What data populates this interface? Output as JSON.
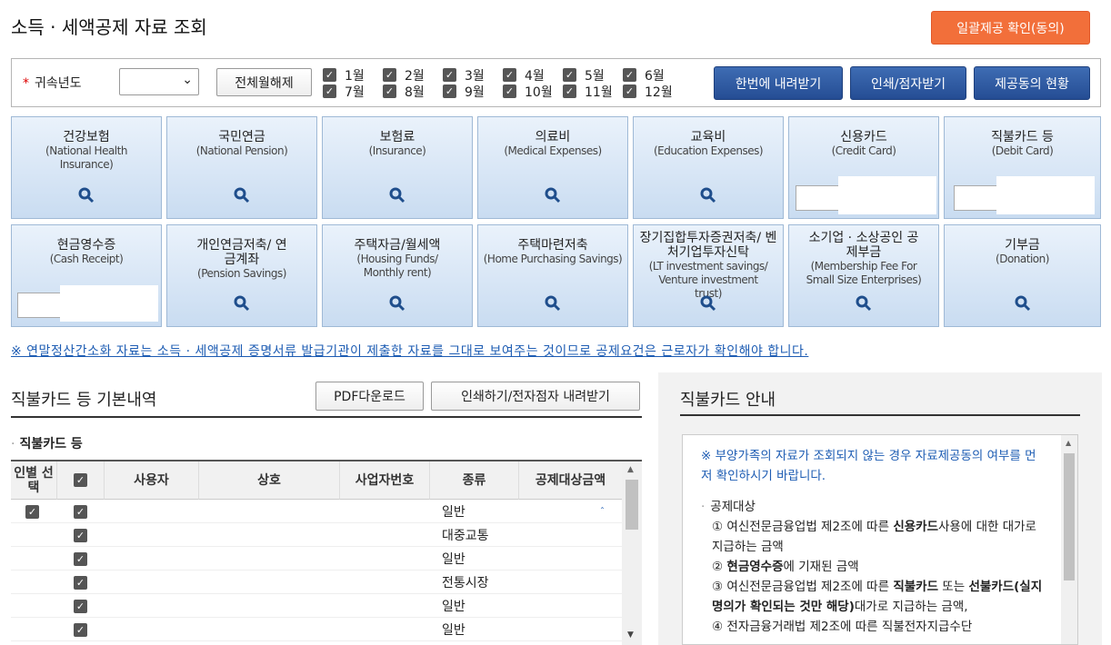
{
  "header": {
    "title": "소득 · 세액공제 자료 조회",
    "consent_button": "일괄제공 확인(동의)"
  },
  "filter": {
    "year_label": "귀속년도",
    "year_value": "",
    "deselect_all": "전체월해제",
    "months": [
      "1월",
      "2월",
      "3월",
      "4월",
      "5월",
      "6월",
      "7월",
      "8월",
      "9월",
      "10월",
      "11월",
      "12월"
    ],
    "download_all": "한번에 내려받기",
    "print_button": "인쇄/점자받기",
    "consent_status": "제공동의 현황"
  },
  "tiles": [
    {
      "ko": "건강보험",
      "en": "(National Health Insurance)"
    },
    {
      "ko": "국민연금",
      "en": "(National Pension)"
    },
    {
      "ko": "보험료",
      "en": "(Insurance)"
    },
    {
      "ko": "의료비",
      "en": "(Medical Expenses)"
    },
    {
      "ko": "교육비",
      "en": "(Education Expenses)"
    },
    {
      "ko": "신용카드",
      "en": "(Credit Card)"
    },
    {
      "ko": "직불카드 등",
      "en": "(Debit Card)"
    },
    {
      "ko": "현금영수증",
      "en": "(Cash Receipt)"
    },
    {
      "ko": "개인연금저축/ 연금계좌",
      "en": "(Pension Savings)"
    },
    {
      "ko": "주택자금/월세액",
      "en": "(Housing Funds/ Monthly rent)"
    },
    {
      "ko": "주택마련저축",
      "en": "(Home Purchasing Savings)"
    },
    {
      "ko": "장기집합투자증권저축/ 벤처기업투자신탁",
      "en": "(LT investment savings/ Venture investment trust)"
    },
    {
      "ko": "소기업 · 소상공인 공제부금",
      "en": "(Membership Fee For Small Size Enterprises)"
    },
    {
      "ko": "기부금",
      "en": "(Donation)"
    }
  ],
  "notice": "※ 연말정산간소화 자료는 소득 · 세액공제 증명서류 발급기관이 제출한 자료를 그대로 보여주는 것이므로 공제요건은 근로자가 확인해야 합니다.",
  "detail": {
    "title": "직불카드 등 기본내역",
    "pdf_button": "PDF다운로드",
    "print_button": "인쇄하기/전자점자 내려받기",
    "section_label": "직불카드 등",
    "columns": [
      "인별 선택",
      "",
      "사용자",
      "상호",
      "사업자번호",
      "종류",
      "공제대상금액"
    ],
    "rows": [
      {
        "type": "일반"
      },
      {
        "type": "대중교통"
      },
      {
        "type": "일반"
      },
      {
        "type": "전통시장"
      },
      {
        "type": "일반"
      },
      {
        "type": "일반"
      }
    ]
  },
  "guide": {
    "title": "직불카드 안내",
    "line1": "※ 부양가족의 자료가 조회되지 않는 경우 자료제공동의 여부를 먼저 확인하시기 바랍니다.",
    "bullet": "공제대상",
    "item1a": "① 여신전문금융업법 제2조에 따른 ",
    "item1b": "신용카드",
    "item1c": "사용에 대한 대가로 지급하는 금액",
    "item2a": "② ",
    "item2b": "현금영수증",
    "item2c": "에 기재된 금액",
    "item3a": "③ 여신전문금융업법 제2조에 따른 ",
    "item3b": "직불카드",
    "item3c": " 또는 ",
    "item3d": "선불카드(실지명의가 확인되는 것만 해당)",
    "item3e": "대가로 지급하는 금액,",
    "item4": "④ 전자금융거래법 제2조에 따른 직불전자지급수단"
  }
}
